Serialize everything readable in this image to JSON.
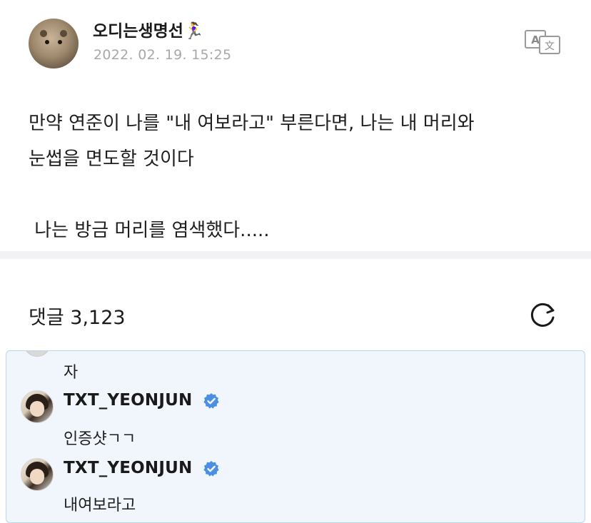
{
  "post": {
    "author": "오디는생명선🏃‍♀️",
    "date": "2022. 02. 19. 15:25",
    "body": "만약 연준이 나를 \"내 여보라고\" 부른다면, 나는 내 머리와\n눈썹을 면도할 것이다\n\n 나는 방금 머리를 염색했다.....",
    "translate_icon": "translate-icon"
  },
  "comments": {
    "title": "댓글 3,123",
    "refresh_icon": "refresh-icon",
    "partial_text": "자",
    "items": [
      {
        "author": "TXT_YEONJUN",
        "text": "인증샷ㄱㄱ",
        "verified": true
      },
      {
        "author": "TXT_YEONJUN",
        "text": "내여보라고",
        "verified": true
      }
    ]
  },
  "colors": {
    "highlight_bg": "#f0f6fc",
    "highlight_border": "#bcd6f0",
    "verified_blue": "#4a90e2",
    "date_gray": "#a8a8a8"
  }
}
